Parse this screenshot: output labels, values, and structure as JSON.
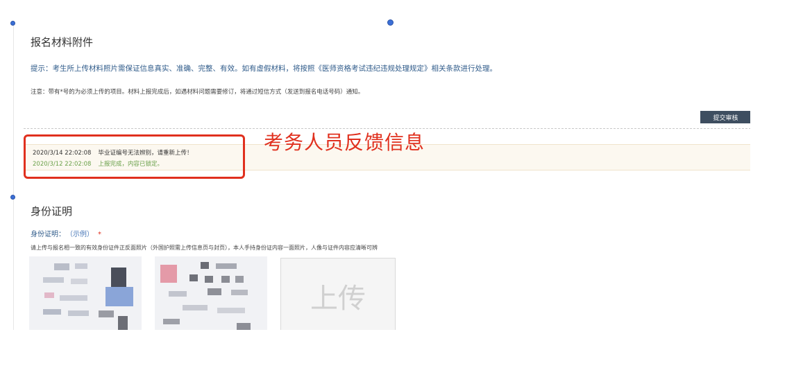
{
  "section1": {
    "title": "报名材料附件",
    "hint": "提示：考生所上传材料照片需保证信息真实、准确、完整、有效。如有虚假材料，将按照《医师资格考试违纪违规处理规定》相关条款进行处理。",
    "note": "注意：带有*号的为必须上传的项目。材料上报完成后，如遇材料问题需要修订，将通过短信方式（发送到报名电话号码）通知。",
    "submit_label": "提交审核"
  },
  "feedback": {
    "entries": [
      {
        "time": "2020/3/14 22:02:08",
        "message": "毕业证编号无法辨别，请重新上传！"
      },
      {
        "time": "2020/3/12 22:02:08",
        "message": "上报完成，内容已锁定。"
      }
    ],
    "annotation": "考务人员反馈信息"
  },
  "section2": {
    "title": "身份证明",
    "field_label": "身份证明：",
    "example_link": "（示例）",
    "required_mark": "*",
    "description": "请上传与报名相一致的有效身份证件正反面照片（外国护照需上传信息页与封页），本人手持身份证内容一面照片，人像与证件内容应清晰可辨",
    "upload_label": "上传"
  },
  "colors": {
    "annotation_red": "#e0301e",
    "hint_blue": "#2f5b8a",
    "success_green": "#6aa14a",
    "button_dark": "#3e4e60",
    "feedback_bg": "#fcf8f0"
  }
}
